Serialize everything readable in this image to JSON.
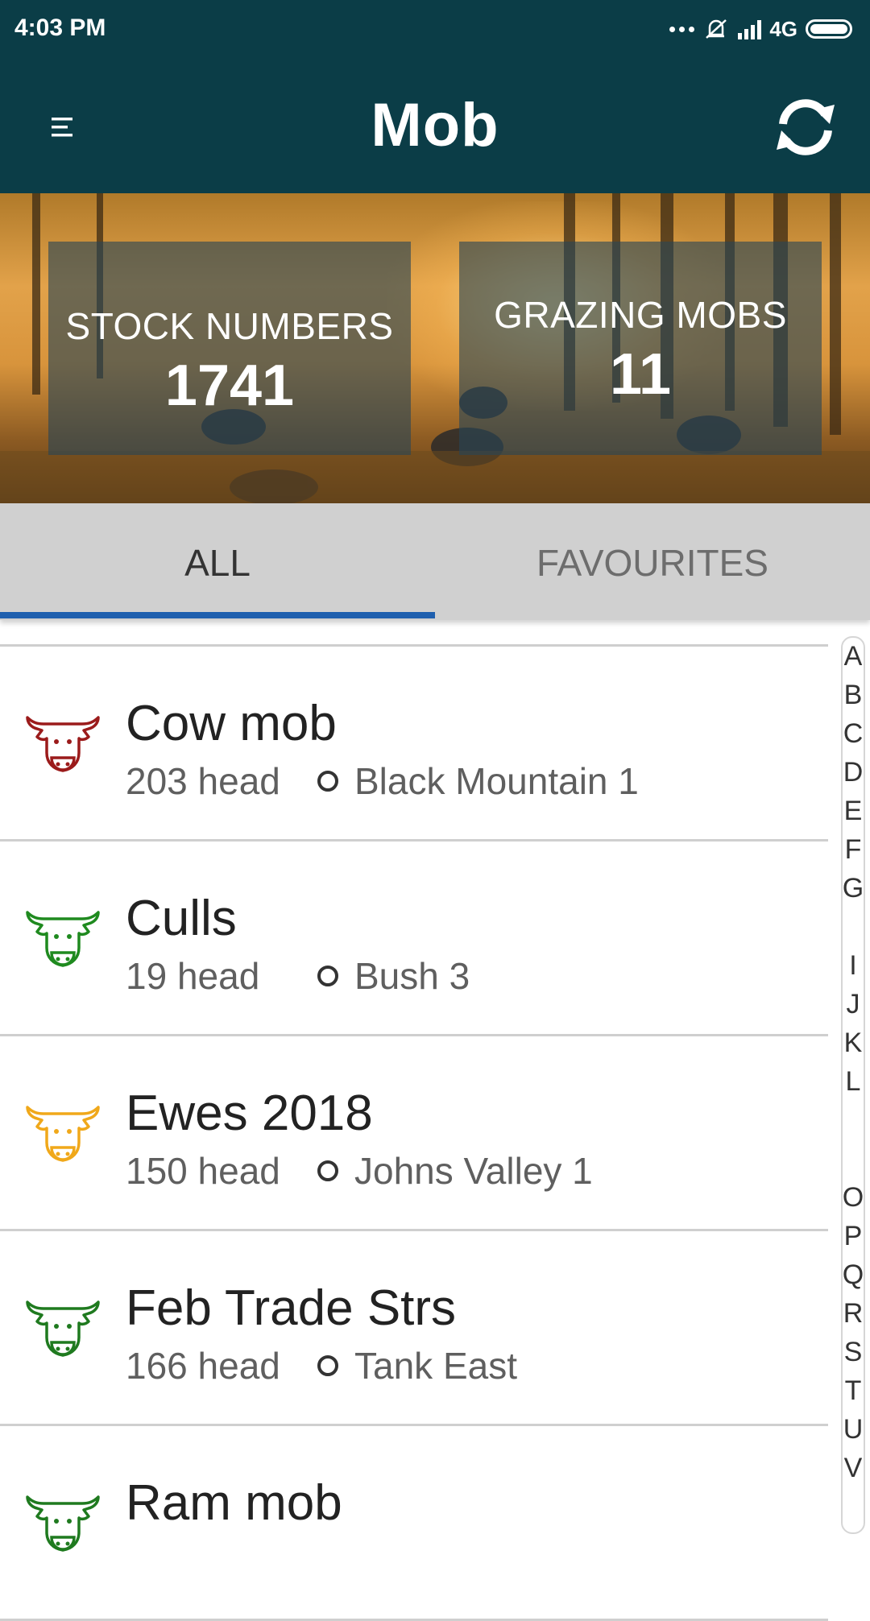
{
  "status_bar": {
    "time": "4:03 PM",
    "network": "4G"
  },
  "app_bar": {
    "title": "Mob",
    "menu_icon": "menu-icon",
    "sync_icon": "sync-icon"
  },
  "stats": {
    "stock_label": "STOCK NUMBERS",
    "stock_value": "1741",
    "grazing_label": "GRAZING MOBS",
    "grazing_value": "11"
  },
  "tabs": [
    {
      "label": "ALL",
      "selected": true
    },
    {
      "label": "FAVOURITES",
      "selected": false
    }
  ],
  "mobs": [
    {
      "name": "Cow mob",
      "head": "203 head",
      "paddock": "Black Mountain 1",
      "icon": "cow-icon",
      "color": "#9b1b1b"
    },
    {
      "name": "Culls",
      "head": "19 head",
      "paddock": "Bush 3",
      "icon": "cow-icon",
      "color": "#1f8a1f"
    },
    {
      "name": "Ewes 2018",
      "head": "150 head",
      "paddock": "Johns Valley 1",
      "icon": "cow-icon",
      "color": "#f0a81a"
    },
    {
      "name": "Feb Trade Strs",
      "head": "166 head",
      "paddock": "Tank East",
      "icon": "cow-icon",
      "color": "#1f7a1f"
    },
    {
      "name": "Ram mob",
      "head": "",
      "paddock": "",
      "icon": "cow-icon",
      "color": "#1f7a1f"
    }
  ],
  "index_letters": [
    "A",
    "B",
    "C",
    "D",
    "E",
    "F",
    "G",
    "",
    "I",
    "J",
    "K",
    "L",
    "",
    "",
    "O",
    "P",
    "Q",
    "R",
    "S",
    "T",
    "U",
    "V"
  ],
  "colors": {
    "primary": "#0b3d47",
    "tab_indicator": "#1f5fae",
    "tab_background": "#d0d0d0"
  }
}
